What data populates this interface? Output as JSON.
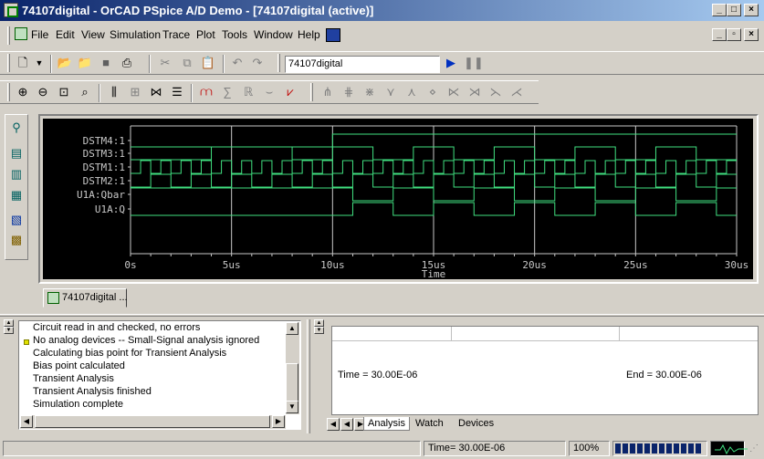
{
  "window": {
    "title": "74107digital - OrCAD PSpice A/D Demo - [74107digital (active)]"
  },
  "menu": [
    "File",
    "Edit",
    "View",
    "Simulation",
    "Trace",
    "Plot",
    "Tools",
    "Window",
    "Help"
  ],
  "toolbar": {
    "profile_value": "74107digital"
  },
  "plot": {
    "traces": [
      "DSTM4:1",
      "DSTM3:1",
      "DSTM1:1",
      "DSTM2:1",
      "U1A:Qbar",
      "U1A:Q"
    ],
    "x_ticks": [
      "0s",
      "5us",
      "10us",
      "15us",
      "20us",
      "25us",
      "30us"
    ],
    "x_label": "Time",
    "colors": {
      "background": "#000000",
      "trace": "#40e080",
      "grid": "#c8c8c8"
    }
  },
  "tab": {
    "label": "74107digital ..."
  },
  "output": {
    "lines": [
      "Circuit read in and checked, no errors",
      "No analog devices -- Small-Signal analysis ignored",
      "Calculating bias point for Transient Analysis",
      "Bias point calculated",
      "Transient Analysis",
      "Transient Analysis finished",
      "Simulation complete"
    ]
  },
  "sim": {
    "time_text": "Time =  30.00E-06",
    "end_text": "End =  30.00E-06"
  },
  "sim_tabs": [
    "Analysis",
    "Watch",
    "Devices"
  ],
  "status": {
    "time": "Time= 30.00E-06",
    "zoom": "100%",
    "progress": 1.0
  }
}
